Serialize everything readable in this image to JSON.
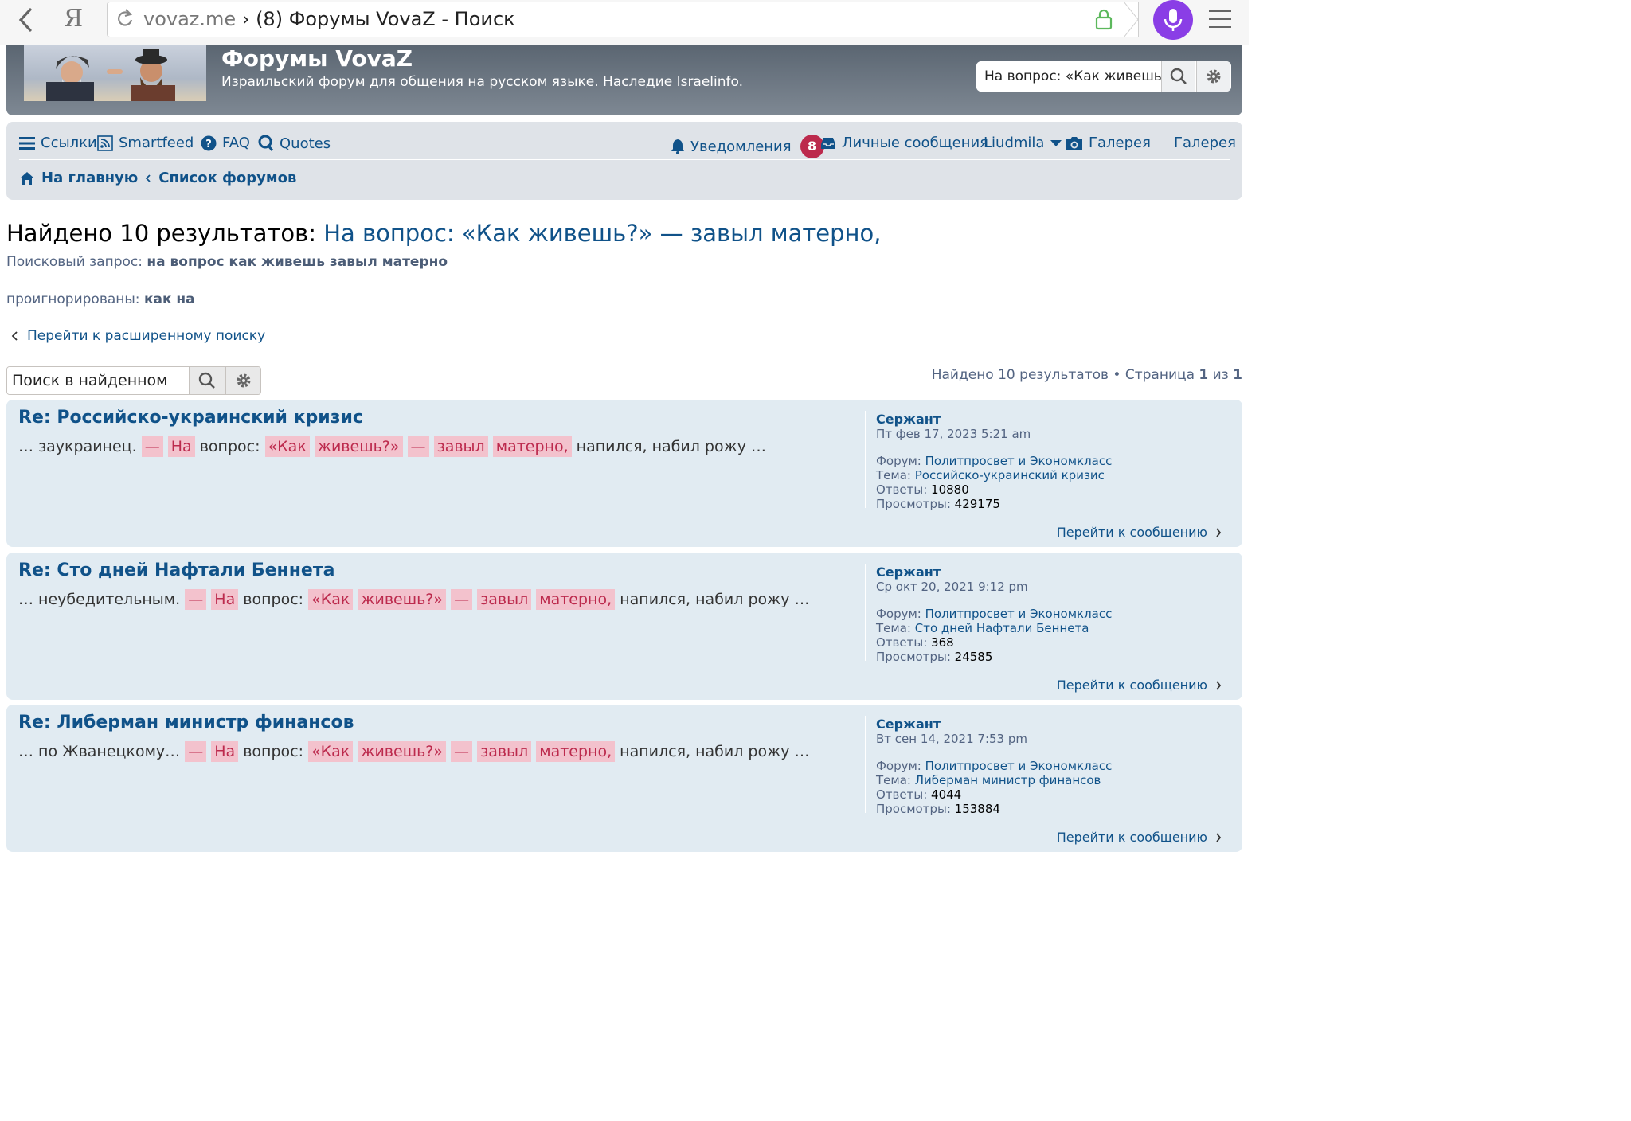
{
  "browser": {
    "ya_logo": "Я",
    "domain": "vovaz.me",
    "separator": "›",
    "page_title": "(8) Форумы VovaZ - Поиск",
    "accent": "#8a3ee6"
  },
  "header": {
    "site_title": "Форумы VovaZ",
    "site_description": "Израильский форум для общения на русском языке. Наследие Israelinfo.",
    "search_value": "На вопрос: «Как живешь?» — завыл матерно,"
  },
  "nav": {
    "links": "Ссылки",
    "smartfeed": "Smartfeed",
    "faq": "FAQ",
    "quotes": "Quotes",
    "notifications": "Уведомления",
    "notifications_count": "8",
    "messages": "Личные сообщения",
    "user": "Liudmila",
    "gallery_icon_label": "Галерея",
    "gallery": "Галерея",
    "home": "На главную",
    "forum_list": "Список форумов"
  },
  "results": {
    "title_prefix": "Найдено 10 результатов:",
    "title_query": "На вопрос: «Как живешь?» — завыл матерно,",
    "query_label": "Поисковый запрос:",
    "query_value": "на вопрос как живешь завыл матерно",
    "ignored_label": "проигнорированы:",
    "ignored_value": "как на",
    "advanced_link": "Перейти к расширенному поиску",
    "in_results_placeholder": "Поиск в найденном",
    "pagination_prefix": "Найдено 10 результатов • Страница",
    "page_current": "1",
    "page_of": "из",
    "page_total": "1"
  },
  "labels": {
    "forum": "Форум:",
    "topic": "Тема:",
    "replies": "Ответы:",
    "views": "Просмотры:",
    "goto": "Перейти к сообщению"
  },
  "posts": [
    {
      "title": "Re: Российско-украинский кризис",
      "prefix": "… заукраинец.",
      "author": "Сержант",
      "date": "Пт фев 17, 2023 5:21 am",
      "forum": "Политпросвет и Экономкласс",
      "topic": "Российско-украинский кризис",
      "replies": "10880",
      "views": "429175"
    },
    {
      "title": "Re: Сто дней Нафтали Беннета",
      "prefix": "… неубедительным.",
      "author": "Сержант",
      "date": "Ср окт 20, 2021 9:12 pm",
      "forum": "Политпросвет и Экономкласс",
      "topic": "Сто дней Нафтали Беннета",
      "replies": "368",
      "views": "24585"
    },
    {
      "title": "Re: Либерман министр финансов",
      "prefix": "… по Жванецкому…",
      "author": "Сержант",
      "date": "Вт сен 14, 2021 7:53 pm",
      "forum": "Политпросвет и Экономкласс",
      "topic": "Либерман министр финансов",
      "replies": "4044",
      "views": "153884"
    }
  ],
  "snippet": {
    "dash": "—",
    "na": "На",
    "vopros": "вопрос:",
    "kak": "«Как",
    "zhivesh": "живешь?»",
    "zavyl": "завыл",
    "materno": "матерно,",
    "suffix": "напился, набил рожу …"
  }
}
